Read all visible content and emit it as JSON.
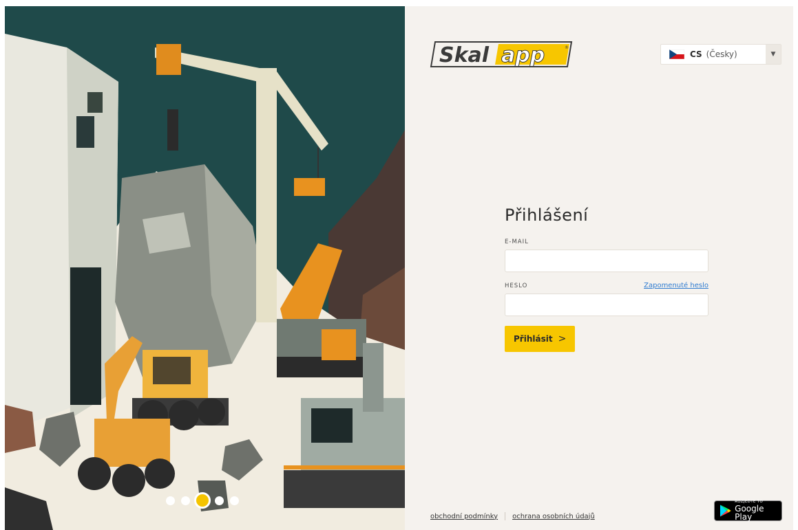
{
  "hero": {
    "carousel_count": 5,
    "carousel_active": 3
  },
  "brand": {
    "logo_part1": "Skal",
    "logo_part2": "app",
    "registered_mark": "®",
    "accent_color": "#f7c600"
  },
  "language": {
    "code": "CS",
    "name": "(Česky)",
    "flag_icon": "czech-flag-icon",
    "dropdown_icon": "caret-down-icon"
  },
  "login": {
    "title": "Přihlášení",
    "email_label": "E-MAIL",
    "email_value": "",
    "password_label": "HESLO",
    "password_value": "",
    "forgot_password": "Zapomenuté heslo",
    "submit_label": "Přihlásit",
    "submit_icon": "chevron-right-icon",
    "submit_chevron": ">"
  },
  "footer": {
    "terms": "obchodní podmínky",
    "privacy": "ochrana osobních údajů"
  },
  "store_badge": {
    "small_text": "ROZJEĎTE TO",
    "store_name": "Google Play",
    "icon": "google-play-icon"
  }
}
